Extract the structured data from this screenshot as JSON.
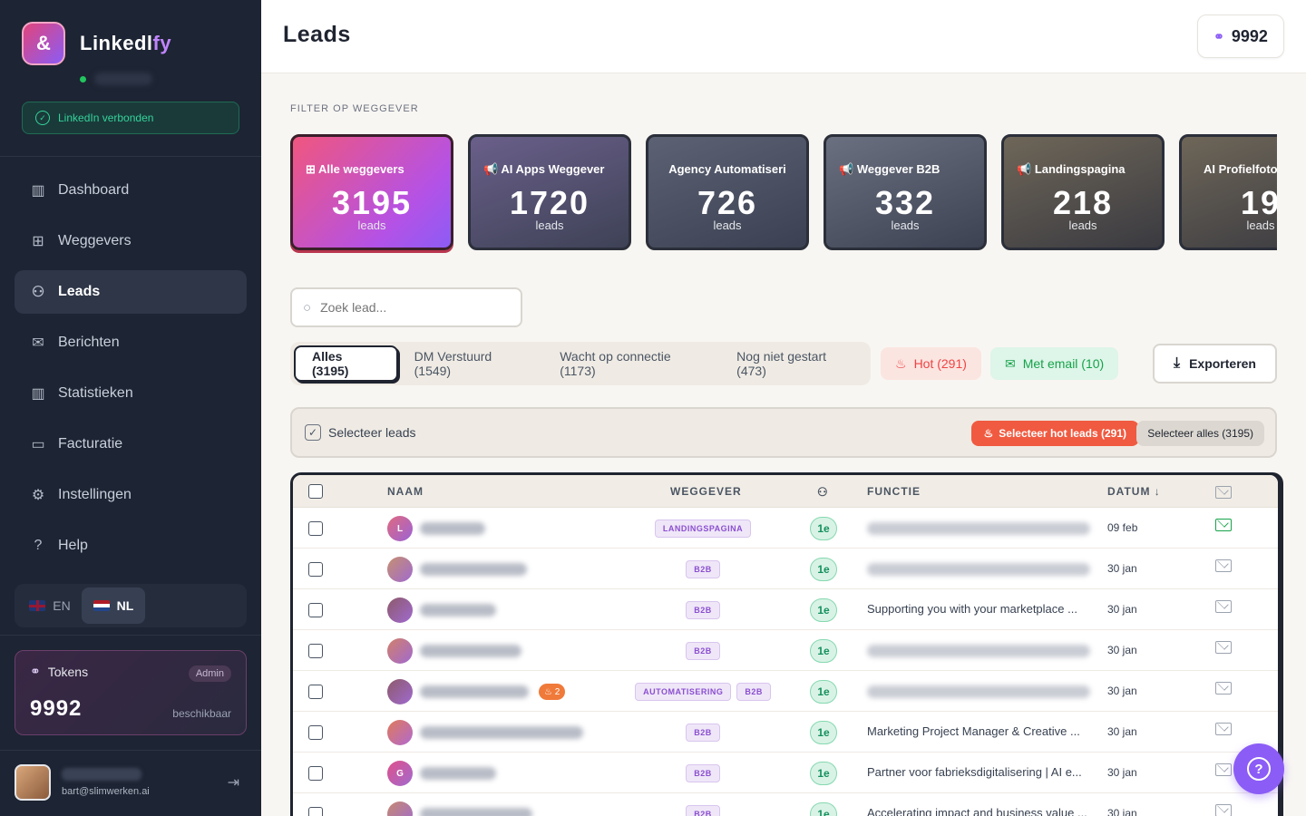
{
  "app": {
    "name_part1": "Linkedl",
    "name_part2": "fy",
    "connected_label": "LinkedIn verbonden"
  },
  "sidebar": {
    "items": [
      {
        "label": "Dashboard",
        "icon": "bar-chart-icon"
      },
      {
        "label": "Weggevers",
        "icon": "gift-icon"
      },
      {
        "label": "Leads",
        "icon": "users-icon"
      },
      {
        "label": "Berichten",
        "icon": "mail-icon"
      },
      {
        "label": "Statistieken",
        "icon": "bar-chart-icon"
      },
      {
        "label": "Facturatie",
        "icon": "credit-card-icon"
      },
      {
        "label": "Instellingen",
        "icon": "gear-icon"
      },
      {
        "label": "Help",
        "icon": "help-circle-icon"
      }
    ],
    "lang_en": "EN",
    "lang_nl": "NL",
    "tokens": {
      "label": "Tokens",
      "role": "Admin",
      "value": "9992",
      "sub": "beschikbaar"
    },
    "user": {
      "email": "bart@slimwerken.ai"
    }
  },
  "header": {
    "title": "Leads",
    "token_count": "9992"
  },
  "filter": {
    "label": "FILTER OP WEGGEVER",
    "cards": [
      {
        "title": "Alle weggevers",
        "value": "3195",
        "unit": "leads"
      },
      {
        "title": "AI Apps Weggever",
        "value": "1720",
        "unit": "leads"
      },
      {
        "title": "Agency Automatiseri",
        "value": "726",
        "unit": "leads"
      },
      {
        "title": "Weggever B2B",
        "value": "332",
        "unit": "leads"
      },
      {
        "title": "Landingspagina",
        "value": "218",
        "unit": "leads"
      },
      {
        "title": "AI Profielfoto",
        "value": "19",
        "unit": "leads"
      }
    ]
  },
  "search": {
    "placeholder": "Zoek lead..."
  },
  "tabs": [
    {
      "label": "Alles (3195)"
    },
    {
      "label": "DM Verstuurd (1549)"
    },
    {
      "label": "Wacht op connectie (1173)"
    },
    {
      "label": "Nog niet gestart (473)"
    }
  ],
  "chips": {
    "hot": "Hot (291)",
    "email": "Met email (10)"
  },
  "export_label": "Exporteren",
  "select_bar": {
    "label": "Selecteer leads",
    "hot_button": "Selecteer hot leads (291)",
    "all_button": "Selecteer alles (3195)"
  },
  "table": {
    "headers": {
      "naam": "NAAM",
      "weggever": "WEGGEVER",
      "functie": "FUNCTIE",
      "datum": "DATUM"
    },
    "rows": [
      {
        "initial": "L",
        "tags": [
          "LANDINGSPAGINA"
        ],
        "degree": "1e",
        "function": "",
        "date": "09 feb",
        "email": true
      },
      {
        "initial": "",
        "tags": [
          "B2B"
        ],
        "degree": "1e",
        "function": "",
        "date": "30 jan",
        "email": false
      },
      {
        "initial": "",
        "tags": [
          "B2B"
        ],
        "degree": "1e",
        "function": "Supporting you with your marketplace ...",
        "date": "30 jan",
        "email": false
      },
      {
        "initial": "",
        "tags": [
          "B2B"
        ],
        "degree": "1e",
        "function": "",
        "date": "30 jan",
        "email": false
      },
      {
        "initial": "",
        "tags": [
          "AUTOMATISERING",
          "B2B"
        ],
        "degree": "1e",
        "function": "",
        "date": "30 jan",
        "email": false,
        "hot": "2"
      },
      {
        "initial": "",
        "tags": [
          "B2B"
        ],
        "degree": "1e",
        "function": "Marketing Project Manager & Creative ...",
        "date": "30 jan",
        "email": false
      },
      {
        "initial": "G",
        "tags": [
          "B2B"
        ],
        "degree": "1e",
        "function": "Partner voor fabrieksdigitalisering | AI e...",
        "date": "30 jan",
        "email": false
      },
      {
        "initial": "",
        "tags": [
          "B2B"
        ],
        "degree": "1e",
        "function": "Accelerating impact and business value ...",
        "date": "30 jan",
        "email": false
      }
    ]
  },
  "colors": {
    "accent": "#8b5cf6",
    "sidebar_bg": "#1d2433",
    "hot": "#f05a40",
    "success": "#16a34a"
  }
}
